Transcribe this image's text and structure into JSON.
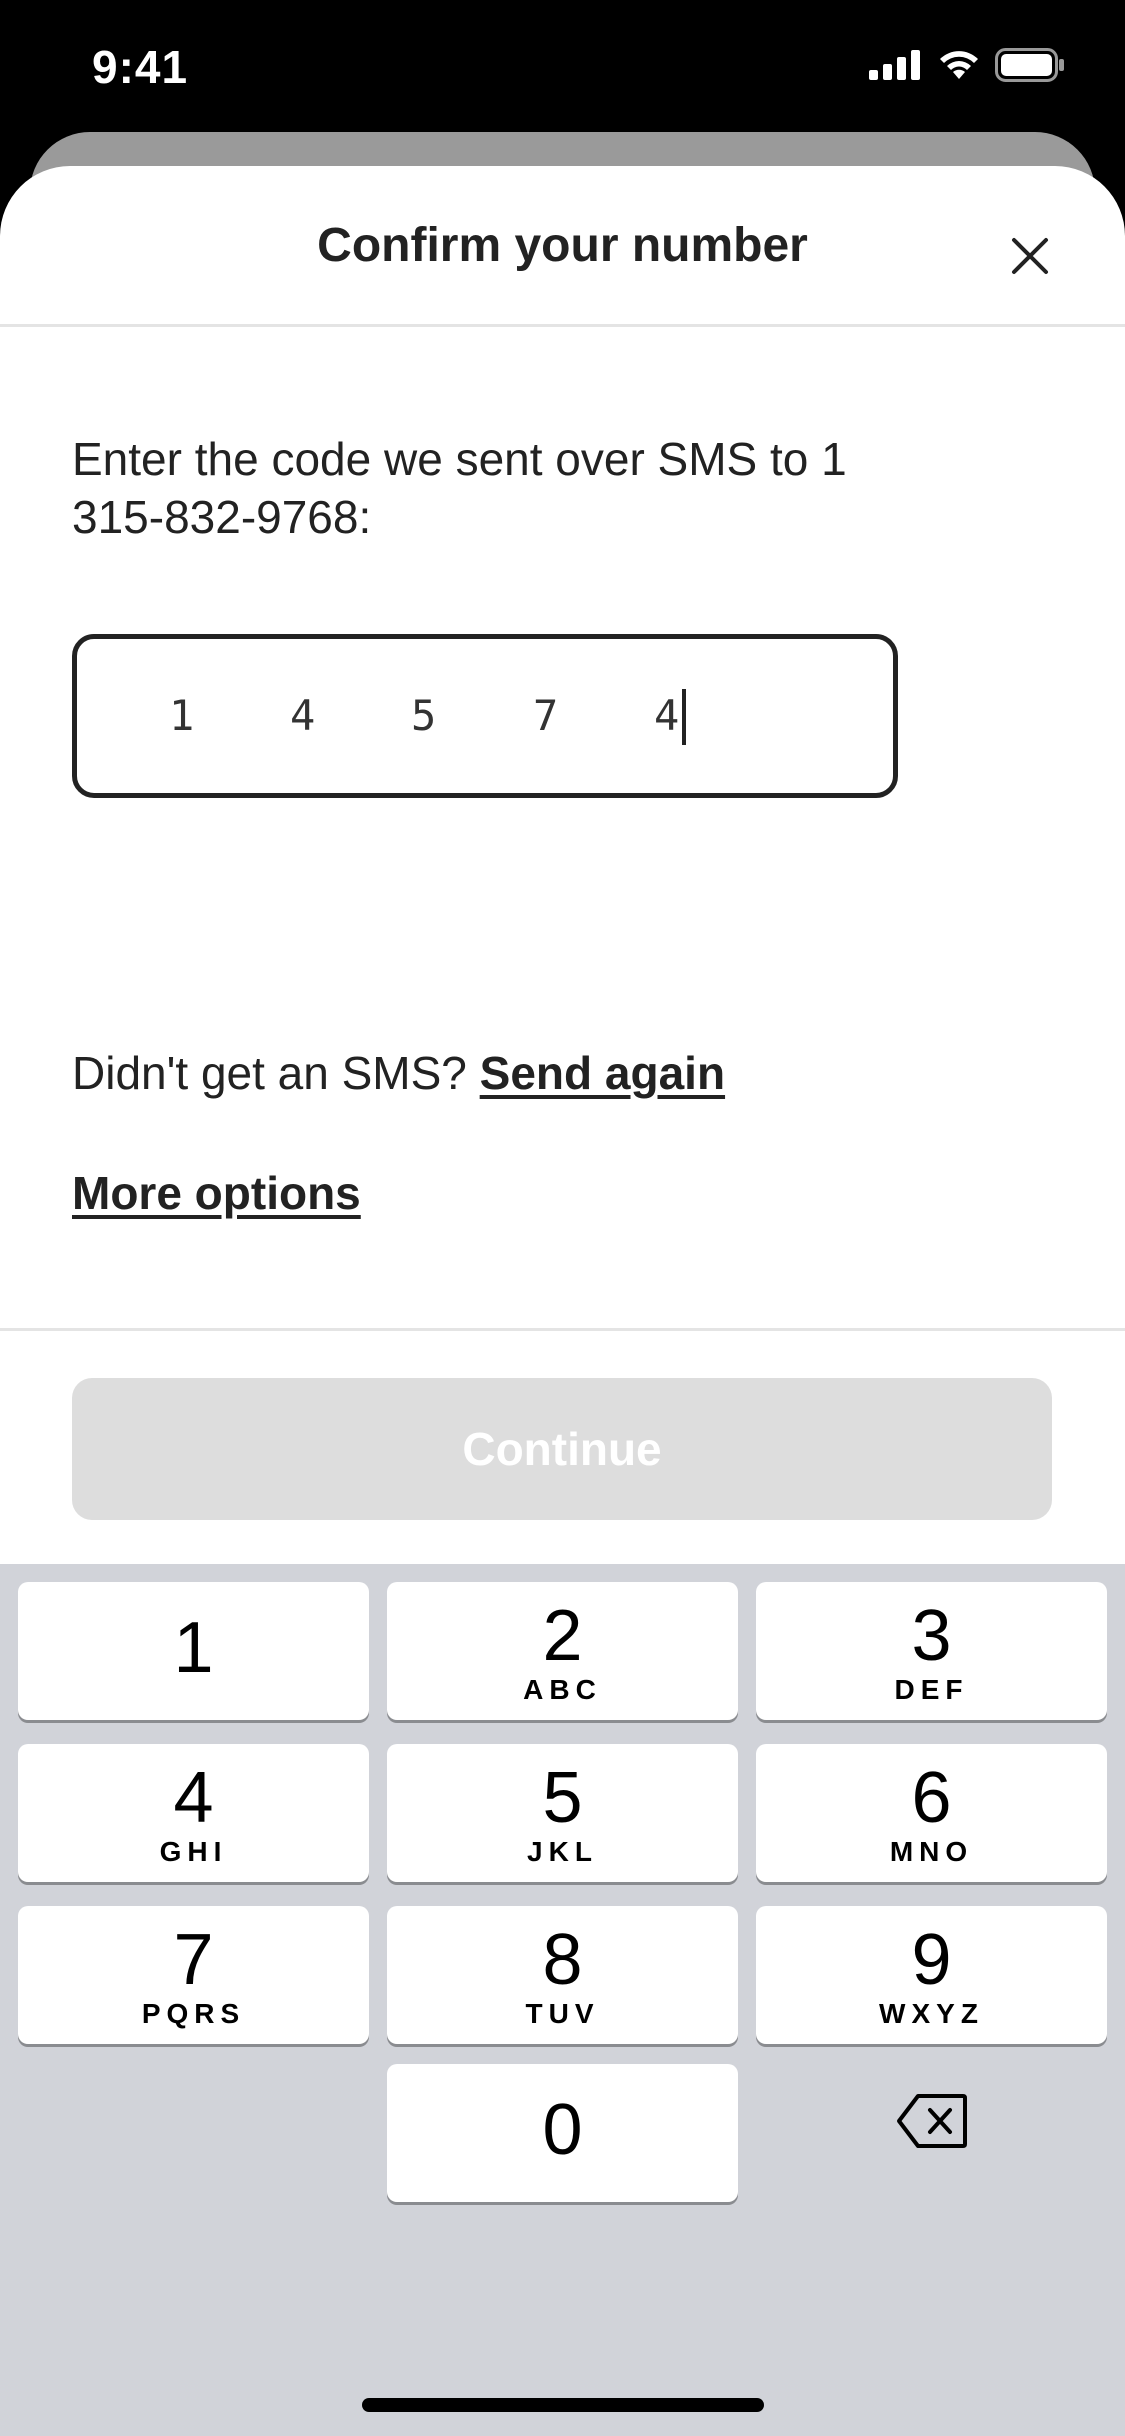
{
  "status_bar": {
    "time": "9:41"
  },
  "header": {
    "title": "Confirm your number",
    "close_icon": "close-icon"
  },
  "instruction": {
    "line1": "Enter the code we sent over SMS to 1",
    "line2": "315-832-9768:"
  },
  "code_input": {
    "digits": [
      "1",
      "4",
      "5",
      "7",
      "4"
    ]
  },
  "resend": {
    "prompt": "Didn't get an SMS?",
    "link": "Send again"
  },
  "more_options": {
    "label": "More options"
  },
  "continue_button": {
    "label": "Continue"
  },
  "keypad": {
    "keys": [
      {
        "digit": "1",
        "letters": ""
      },
      {
        "digit": "2",
        "letters": "ABC"
      },
      {
        "digit": "3",
        "letters": "DEF"
      },
      {
        "digit": "4",
        "letters": "GHI"
      },
      {
        "digit": "5",
        "letters": "JKL"
      },
      {
        "digit": "6",
        "letters": "MNO"
      },
      {
        "digit": "7",
        "letters": "PQRS"
      },
      {
        "digit": "8",
        "letters": "TUV"
      },
      {
        "digit": "9",
        "letters": "WXYZ"
      },
      {
        "digit": "0",
        "letters": ""
      }
    ],
    "delete_icon": "backspace-icon"
  },
  "colors": {
    "text": "#222222",
    "continue_disabled": "#dddddd",
    "keypad_bg": "#d1d3d9"
  }
}
